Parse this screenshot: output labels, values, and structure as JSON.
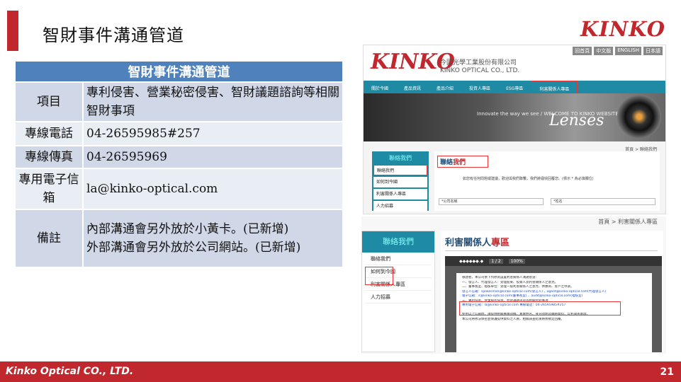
{
  "header": {
    "title": "智財事件溝通管道",
    "brand": "KINKO"
  },
  "table": {
    "heading": "智財事件溝通管道",
    "rows": [
      {
        "label": "項目",
        "value": "專利侵害、營業秘密侵害、智財議題諮詢等相關智財事項"
      },
      {
        "label": "專線電話",
        "value": "04-26595985#257"
      },
      {
        "label": "專線傳真",
        "value": "04-26595969"
      },
      {
        "label": "專用電子信箱",
        "value": "la@kinko-optical.com"
      },
      {
        "label": "備註",
        "value_lines": [
          "內部溝通會另外放於小黃卡。(已新增)",
          "外部溝通會另外放於公司網站。(已新增)"
        ]
      }
    ]
  },
  "website": {
    "logo": "KINKO",
    "company_cn": "今國光學工業股份有限公司",
    "company_en": "KINKO OPTICAL CO., LTD.",
    "top_links": [
      "回首頁",
      "中文版",
      "ENGLISH",
      "日本語"
    ],
    "nav": [
      "關於今國",
      "產品資訊",
      "產品介紹",
      "投資人專區",
      "ESG專區",
      "利害關係人專區"
    ],
    "banner_small": "Innovate the way we see / WELCOME TO KINKO WEBSITE",
    "banner_text": "Lenses",
    "breadcrumb": "首頁 > 聯絡我們",
    "sidebar_head": "聯絡我們",
    "sidebar_items": [
      "聯絡我們",
      "如何到今國",
      "利害關係人專區",
      "人力招募"
    ],
    "content_title_a": "聯絡",
    "content_title_b": "我們",
    "content_note": "如您有任何問題或建議，歡迎與我們聯繫，我們將儘快回覆您。(標示 * 為必填欄位)",
    "fields": [
      "*公司名稱",
      "*姓名"
    ]
  },
  "website2": {
    "breadcrumb": "首頁 > 利害關係人專區",
    "sidebar_head": "聯絡我們",
    "sidebar_items": [
      "聯絡我們",
      "如何到今國",
      "利害關係人專區",
      "人力招募"
    ],
    "title_a": "利害關係人",
    "title_b": "專區",
    "pdf_toolbar": [
      "◆◆◆◆◆◆.◆",
      "1 / 2",
      "100%"
    ],
    "pdf_lines": [
      "敬啟者，本公司依下列原則設置利害關係人溝通管道：",
      "一、發言人、代理發言人：受理股東、投資人及利害關係人之意見。",
      "二、董事長室、稽核單位：受理一般利害關係人之意見、供應商、客戶之申訴。",
      "發言人信箱：spokesman@kinko-optical.com(發言人) ，agent@kinko-optical.com(代理發言人)",
      "電子信箱：ir@kinko-optical.com(董事長室) ，audit@kinko-optical.com(稽核室)",
      "三、專利侵害、營業秘密侵害、智財議題諮詢等相關智財事項",
      "專用電子信箱：la@kinko-optical.com 專線電話：04-26595985#257",
      "",
      "使用以上信箱時，請提供相關事實證據、真實姓名、身分證明及聯絡資料，以利調查處理，",
      "本公司將依法保密並保護提供資料之人員，相關調查結果將依規定回覆。"
    ]
  },
  "footer": {
    "company": "Kinko Optical CO., LTD.",
    "page": "21"
  }
}
